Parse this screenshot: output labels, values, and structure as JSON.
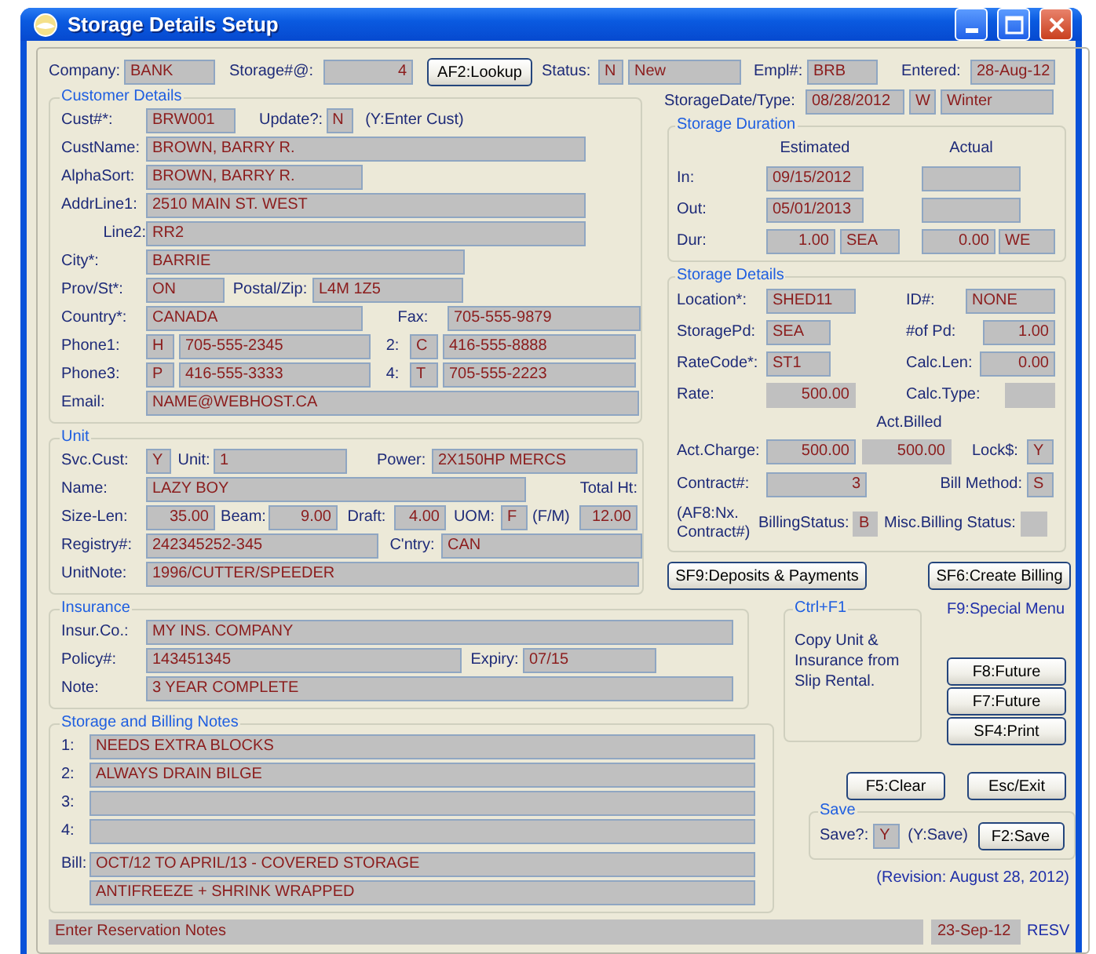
{
  "window": {
    "title": "Storage Details Setup"
  },
  "header": [
    {
      "kind": "label",
      "text": "Company:"
    },
    {
      "kind": "field",
      "value": "BANK"
    },
    {
      "kind": "label",
      "text": "Storage#@:"
    },
    {
      "kind": "field",
      "value": "4"
    },
    {
      "kind": "button",
      "text": "AF2:Lookup"
    },
    {
      "kind": "label",
      "text": "Status:"
    },
    {
      "kind": "field",
      "value": "N"
    },
    {
      "kind": "field",
      "value": "New"
    },
    {
      "kind": "label",
      "text": "Empl#:"
    },
    {
      "kind": "field",
      "value": "BRB"
    },
    {
      "kind": "label",
      "text": "Entered:"
    },
    {
      "kind": "field",
      "value": "28-Aug-12"
    }
  ],
  "customer_details": {
    "title": "Customer Details",
    "rows": [
      {
        "items": [
          {
            "kind": "label",
            "text": "Cust#*:"
          },
          {
            "kind": "field",
            "value": "BRW001"
          },
          {
            "kind": "label",
            "text": "Update?:"
          },
          {
            "kind": "field",
            "value": "N"
          },
          {
            "kind": "label",
            "text": "(Y:Enter Cust)"
          }
        ]
      },
      {
        "items": [
          {
            "kind": "label",
            "text": "CustName:"
          },
          {
            "kind": "field",
            "value": "BROWN, BARRY R."
          }
        ]
      },
      {
        "items": [
          {
            "kind": "label",
            "text": "AlphaSort:"
          },
          {
            "kind": "field",
            "value": "BROWN, BARRY R."
          }
        ]
      },
      {
        "items": [
          {
            "kind": "label",
            "text": "AddrLine1:"
          },
          {
            "kind": "field",
            "value": "2510 MAIN ST. WEST"
          }
        ]
      },
      {
        "items": [
          {
            "kind": "label",
            "text": "Line2:"
          },
          {
            "kind": "field",
            "value": "RR2"
          }
        ]
      },
      {
        "items": [
          {
            "kind": "label",
            "text": "City*:"
          },
          {
            "kind": "field",
            "value": "BARRIE"
          }
        ]
      },
      {
        "items": [
          {
            "kind": "label",
            "text": "Prov/St*:"
          },
          {
            "kind": "field",
            "value": "ON"
          },
          {
            "kind": "label",
            "text": "Postal/Zip:"
          },
          {
            "kind": "field",
            "value": "L4M 1Z5"
          }
        ]
      },
      {
        "items": [
          {
            "kind": "label",
            "text": "Country*:"
          },
          {
            "kind": "field",
            "value": "CANADA"
          },
          {
            "kind": "label",
            "text": "Fax:"
          },
          {
            "kind": "field",
            "value": "705-555-9879"
          }
        ]
      },
      {
        "items": [
          {
            "kind": "label",
            "text": "Phone1:"
          },
          {
            "kind": "field",
            "value": "H"
          },
          {
            "kind": "field",
            "value": "705-555-2345"
          },
          {
            "kind": "label",
            "text": "2:"
          },
          {
            "kind": "field",
            "value": "C"
          },
          {
            "kind": "field",
            "value": "416-555-8888"
          }
        ]
      },
      {
        "items": [
          {
            "kind": "label",
            "text": "Phone3:"
          },
          {
            "kind": "field",
            "value": "P"
          },
          {
            "kind": "field",
            "value": "416-555-3333"
          },
          {
            "kind": "label",
            "text": "4:"
          },
          {
            "kind": "field",
            "value": "T"
          },
          {
            "kind": "field",
            "value": "705-555-2223"
          }
        ]
      },
      {
        "items": [
          {
            "kind": "label",
            "text": "Email:"
          },
          {
            "kind": "field",
            "value": "NAME@WEBHOST.CA"
          }
        ]
      }
    ]
  },
  "unit": {
    "title": "Unit",
    "rows": [
      {
        "items": [
          {
            "kind": "label",
            "text": "Svc.Cust:"
          },
          {
            "kind": "field",
            "value": "Y"
          },
          {
            "kind": "label",
            "text": "Unit:"
          },
          {
            "kind": "field",
            "value": "1"
          },
          {
            "kind": "label",
            "text": "Power:"
          },
          {
            "kind": "field",
            "value": "2X150HP MERCS"
          }
        ]
      },
      {
        "items": [
          {
            "kind": "label",
            "text": "Name:"
          },
          {
            "kind": "field",
            "value": "LAZY BOY"
          },
          {
            "kind": "label",
            "text": "Total Ht:"
          }
        ]
      },
      {
        "items": [
          {
            "kind": "label",
            "text": "Size-Len:"
          },
          {
            "kind": "field",
            "value": "35.00"
          },
          {
            "kind": "label",
            "text": "Beam:"
          },
          {
            "kind": "field",
            "value": "9.00"
          },
          {
            "kind": "label",
            "text": "Draft:"
          },
          {
            "kind": "field",
            "value": "4.00"
          },
          {
            "kind": "label",
            "text": "UOM:"
          },
          {
            "kind": "field",
            "value": "F"
          },
          {
            "kind": "label",
            "text": "(F/M)"
          },
          {
            "kind": "field",
            "value": "12.00"
          }
        ]
      },
      {
        "items": [
          {
            "kind": "label",
            "text": "Registry#:"
          },
          {
            "kind": "field",
            "value": "242345252-345"
          },
          {
            "kind": "label",
            "text": "C'ntry:"
          },
          {
            "kind": "field",
            "value": "CAN"
          }
        ]
      },
      {
        "items": [
          {
            "kind": "label",
            "text": "UnitNote:"
          },
          {
            "kind": "field",
            "value": "1996/CUTTER/SPEEDER"
          }
        ]
      }
    ]
  },
  "storage_date": [
    {
      "kind": "label",
      "text": "StorageDate/Type:"
    },
    {
      "kind": "field",
      "value": "08/28/2012"
    },
    {
      "kind": "field",
      "value": "W"
    },
    {
      "kind": "field",
      "value": "Winter"
    }
  ],
  "storage_duration": {
    "title": "Storage Duration",
    "rows": [
      {
        "items": [
          {
            "kind": "label",
            "text": "Estimated"
          },
          {
            "kind": "label",
            "text": "Actual"
          }
        ]
      },
      {
        "items": [
          {
            "kind": "label",
            "text": "In:"
          },
          {
            "kind": "field",
            "value": "09/15/2012"
          },
          {
            "kind": "field"
          }
        ]
      },
      {
        "items": [
          {
            "kind": "label",
            "text": "Out:"
          },
          {
            "kind": "field",
            "value": "05/01/2013"
          },
          {
            "kind": "field"
          }
        ]
      },
      {
        "items": [
          {
            "kind": "label",
            "text": "Dur:"
          },
          {
            "kind": "field",
            "value": "1.00"
          },
          {
            "kind": "field",
            "value": "SEA"
          },
          {
            "kind": "field",
            "value": "0.00"
          },
          {
            "kind": "field",
            "value": "WE"
          }
        ]
      }
    ]
  },
  "storage_details": {
    "title": "Storage Details",
    "rows": [
      {
        "items": [
          {
            "kind": "label",
            "text": "Location*:"
          },
          {
            "kind": "field",
            "value": "SHED11"
          },
          {
            "kind": "label",
            "text": "ID#:"
          },
          {
            "kind": "field",
            "value": "NONE"
          }
        ]
      },
      {
        "items": [
          {
            "kind": "label",
            "text": "StoragePd:"
          },
          {
            "kind": "field",
            "value": "SEA"
          },
          {
            "kind": "label",
            "text": "#of Pd:"
          },
          {
            "kind": "field",
            "value": "1.00"
          }
        ]
      },
      {
        "items": [
          {
            "kind": "label",
            "text": "RateCode*:"
          },
          {
            "kind": "field",
            "value": "ST1"
          },
          {
            "kind": "label",
            "text": "Calc.Len:"
          },
          {
            "kind": "field",
            "value": "0.00"
          }
        ]
      },
      {
        "items": [
          {
            "kind": "label",
            "text": "Rate:"
          },
          {
            "kind": "field",
            "value": "500.00"
          },
          {
            "kind": "label",
            "text": "Calc.Type:"
          },
          {
            "kind": "field"
          }
        ]
      },
      {
        "items": [
          {
            "kind": "label",
            "text": "Act.Billed"
          }
        ]
      },
      {
        "items": [
          {
            "kind": "label",
            "text": "Act.Charge:"
          },
          {
            "kind": "field",
            "value": "500.00"
          },
          {
            "kind": "field",
            "value": "500.00"
          },
          {
            "kind": "label",
            "text": "Lock$:"
          },
          {
            "kind": "field",
            "value": "Y"
          }
        ]
      },
      {
        "items": [
          {
            "kind": "label",
            "text": "Contract#:"
          },
          {
            "kind": "field",
            "value": "3"
          },
          {
            "kind": "label",
            "text": "Bill Method:"
          },
          {
            "kind": "field",
            "value": "S"
          }
        ]
      },
      {
        "items": [
          {
            "kind": "label",
            "text": "(AF8:Nx. Contract#)"
          },
          {
            "kind": "label",
            "text": "BillingStatus:"
          },
          {
            "kind": "field",
            "value": "B"
          },
          {
            "kind": "label",
            "text": "Misc.Billing Status:"
          },
          {
            "kind": "field"
          }
        ]
      }
    ]
  },
  "action_buttons": [
    {
      "kind": "button",
      "text": "SF9:Deposits & Payments"
    },
    {
      "kind": "button",
      "text": "SF6:Create Billing"
    }
  ],
  "insurance": {
    "title": "Insurance",
    "rows": [
      {
        "items": [
          {
            "kind": "label",
            "text": "Insur.Co.:"
          },
          {
            "kind": "field",
            "value": "MY INS. COMPANY"
          }
        ]
      },
      {
        "items": [
          {
            "kind": "label",
            "text": "Policy#:"
          },
          {
            "kind": "field",
            "value": "143451345"
          },
          {
            "kind": "label",
            "text": "Expiry:"
          },
          {
            "kind": "field",
            "value": "07/15"
          }
        ]
      },
      {
        "items": [
          {
            "kind": "label",
            "text": "Note:"
          },
          {
            "kind": "field",
            "value": "3 YEAR COMPLETE"
          }
        ]
      }
    ]
  },
  "notes": {
    "title": "Storage and Billing Notes",
    "rows": [
      {
        "items": [
          {
            "kind": "label",
            "text": "1:"
          },
          {
            "kind": "field",
            "value": "NEEDS EXTRA BLOCKS"
          }
        ]
      },
      {
        "items": [
          {
            "kind": "label",
            "text": "2:"
          },
          {
            "kind": "field",
            "value": "ALWAYS DRAIN BILGE"
          }
        ]
      },
      {
        "items": [
          {
            "kind": "label",
            "text": "3:"
          },
          {
            "kind": "field"
          }
        ]
      },
      {
        "items": [
          {
            "kind": "label",
            "text": "4:"
          },
          {
            "kind": "field"
          }
        ]
      },
      {
        "items": [
          {
            "kind": "label",
            "text": "Bill:"
          },
          {
            "kind": "field",
            "value": "OCT/12 TO APRIL/13 - COVERED STORAGE"
          }
        ]
      },
      {
        "items": [
          {
            "kind": "field",
            "value": "ANTIFREEZE + SHRINK WRAPPED"
          }
        ]
      }
    ]
  },
  "copy_box": {
    "title": "Ctrl+F1",
    "text": "Copy Unit & Insurance from Slip Rental."
  },
  "special_menu": "F9:Special Menu",
  "side_buttons": [
    {
      "kind": "button",
      "text": "F8:Future"
    },
    {
      "kind": "button",
      "text": "F7:Future"
    },
    {
      "kind": "button",
      "text": "SF4:Print"
    }
  ],
  "clear_exit": [
    {
      "kind": "button",
      "text": "F5:Clear"
    },
    {
      "kind": "button",
      "text": "Esc/Exit"
    }
  ],
  "save": {
    "title": "Save",
    "row": [
      {
        "kind": "label",
        "text": "Save?:"
      },
      {
        "kind": "field",
        "value": "Y"
      },
      {
        "kind": "label",
        "text": "(Y:Save)"
      },
      {
        "kind": "button",
        "text": "F2:Save"
      }
    ]
  },
  "revision": "(Revision: August 28, 2012)",
  "status_bar": [
    {
      "kind": "field",
      "value": "Enter Reservation Notes"
    },
    {
      "kind": "field",
      "value": "23-Sep-12"
    },
    {
      "kind": "label",
      "text": "RESV"
    }
  ]
}
